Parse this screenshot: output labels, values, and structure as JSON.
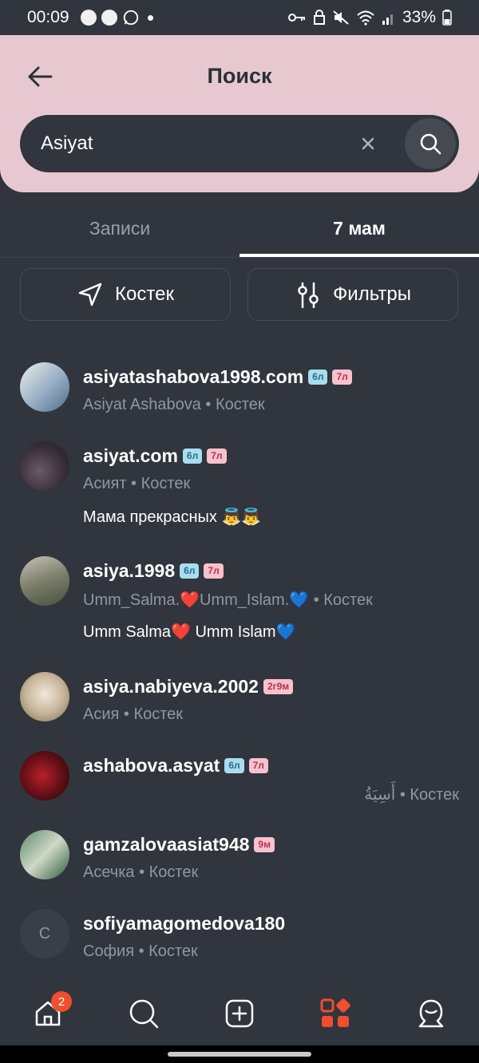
{
  "status_bar": {
    "time": "00:09",
    "battery": "33%"
  },
  "header": {
    "title": "Поиск"
  },
  "search": {
    "value": "Asiyat"
  },
  "tabs": [
    {
      "label": "Записи",
      "active": false
    },
    {
      "label": "7 мам",
      "active": true
    }
  ],
  "filters": {
    "location_label": "Костек",
    "filters_label": "Фильтры"
  },
  "results": [
    {
      "username": "asiyatashabova1998.com",
      "badges": [
        "6л",
        "7л"
      ],
      "subtitle": "Asiyat Ashabova • Костек",
      "bio": ""
    },
    {
      "username": "asiyat.com",
      "badges": [
        "6л",
        "7л"
      ],
      "subtitle": "Асият • Костек",
      "bio": "Мама прекрасных 👼👼"
    },
    {
      "username": "asiya.1998",
      "badges": [
        "6л",
        "7л"
      ],
      "subtitle": "Umm_Salma.❤️Umm_Islam.💙 • Костек",
      "bio": "Umm Salma❤️ Umm Islam💙"
    },
    {
      "username": "asiya.nabiyeva.2002",
      "badges": [
        "2г9м"
      ],
      "subtitle": "Асия • Костек",
      "bio": ""
    },
    {
      "username": "ashabova.asyat",
      "badges": [
        "6л",
        "7л"
      ],
      "subtitle": "Костек • أَسِيَةُ",
      "bio": ""
    },
    {
      "username": "gamzalovaasiat948",
      "badges": [
        "9м"
      ],
      "subtitle": "Асечка • Костек",
      "bio": ""
    },
    {
      "username": "sofiyamagomedova180",
      "badges": [],
      "subtitle": "София • Костек",
      "bio": "",
      "avatar_letter": "С"
    }
  ],
  "bottom_nav": {
    "home_badge": "2"
  },
  "colors": {
    "background": "#31353d",
    "header": "#e8c8d0",
    "accent": "#f04e2d"
  }
}
